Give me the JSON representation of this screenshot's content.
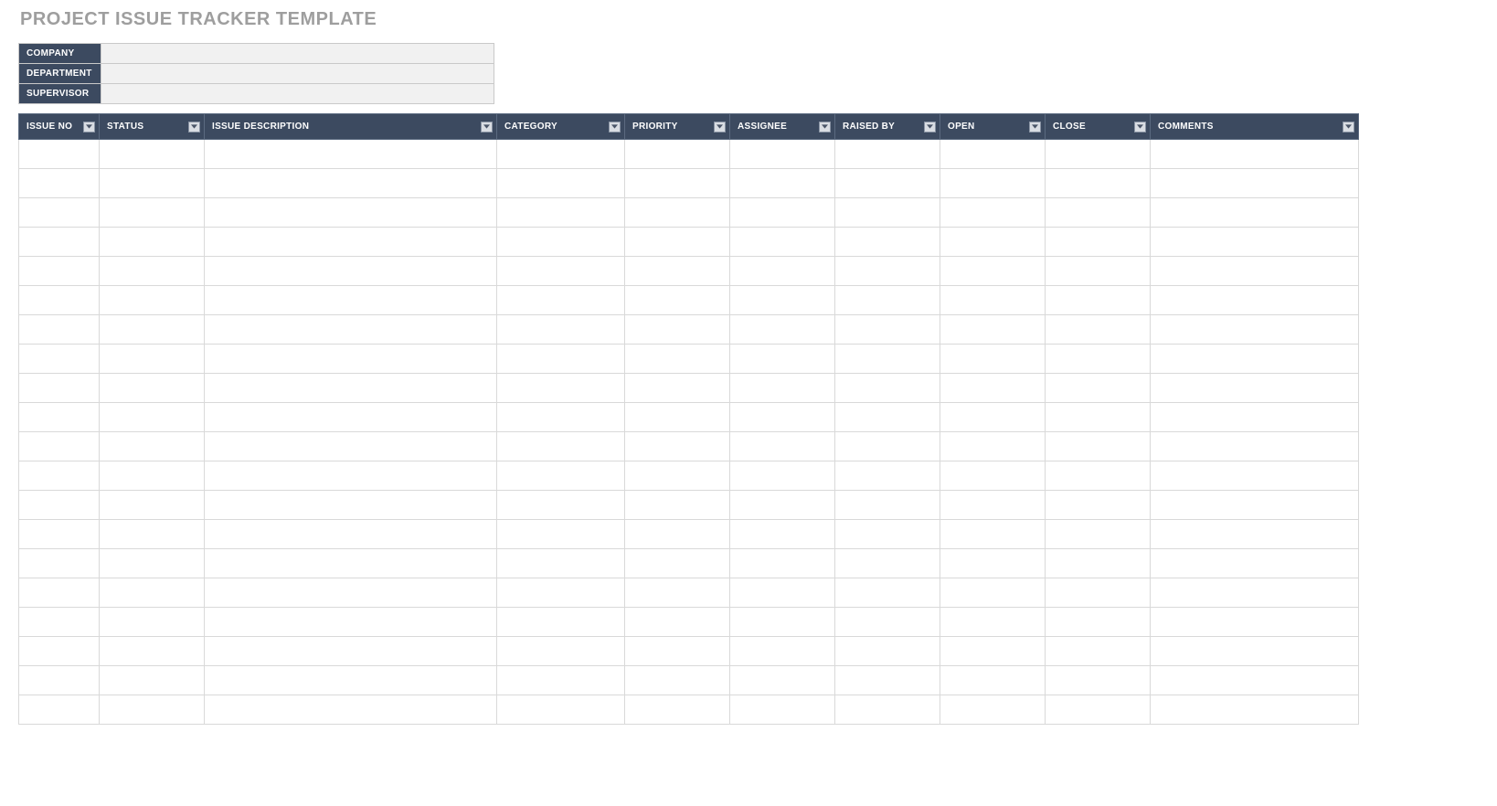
{
  "title": "PROJECT ISSUE TRACKER TEMPLATE",
  "meta": {
    "rows": [
      {
        "label": "COMPANY",
        "value": ""
      },
      {
        "label": "DEPARTMENT",
        "value": ""
      },
      {
        "label": "SUPERVISOR",
        "value": ""
      }
    ]
  },
  "columns": [
    {
      "label": "ISSUE NO",
      "key": "issue_no"
    },
    {
      "label": "STATUS",
      "key": "status"
    },
    {
      "label": "ISSUE DESCRIPTION",
      "key": "description"
    },
    {
      "label": "CATEGORY",
      "key": "category"
    },
    {
      "label": "PRIORITY",
      "key": "priority"
    },
    {
      "label": "ASSIGNEE",
      "key": "assignee"
    },
    {
      "label": "RAISED BY",
      "key": "raised_by"
    },
    {
      "label": "OPEN",
      "key": "open"
    },
    {
      "label": "CLOSE",
      "key": "close"
    },
    {
      "label": "COMMENTS",
      "key": "comments"
    }
  ],
  "row_count": 20,
  "colors": {
    "header_bg": "#3c4a60",
    "meta_value_bg": "#f1f1f1",
    "title_color": "#9e9e9e"
  }
}
